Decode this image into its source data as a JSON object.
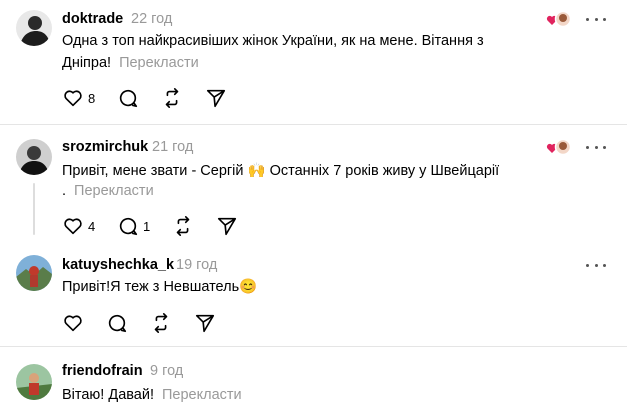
{
  "posts": [
    {
      "username": "doktrade",
      "time": "22 год",
      "text_line1": "Одна з топ найкрасивіших жінок України, як на мене. Вітання з",
      "text_line2": "Дніпра!",
      "translate": "Перекласти",
      "likes": "8",
      "has_likers": true
    },
    {
      "username": "srozmirchuk",
      "time": "21 год",
      "text_line1": "Привіт, мене звати - Сергій 🙌 Останніх 7 років живу у Швейцарії",
      "text_line2": ".",
      "translate": "Перекласти",
      "likes": "4",
      "replies": "1",
      "has_likers": true
    },
    {
      "username": "katuyshechka_k",
      "time": "19 год",
      "text_line1": "Привіт!Я теж з Невшатель😊"
    },
    {
      "username": "friendofrain",
      "time": "9 год",
      "text_line1": "Вітаю! Давай!",
      "translate": "Перекласти"
    }
  ],
  "colors": {
    "liker_heart": "#e0245e",
    "muted": "#999999",
    "divider": "#e5e5e5"
  }
}
